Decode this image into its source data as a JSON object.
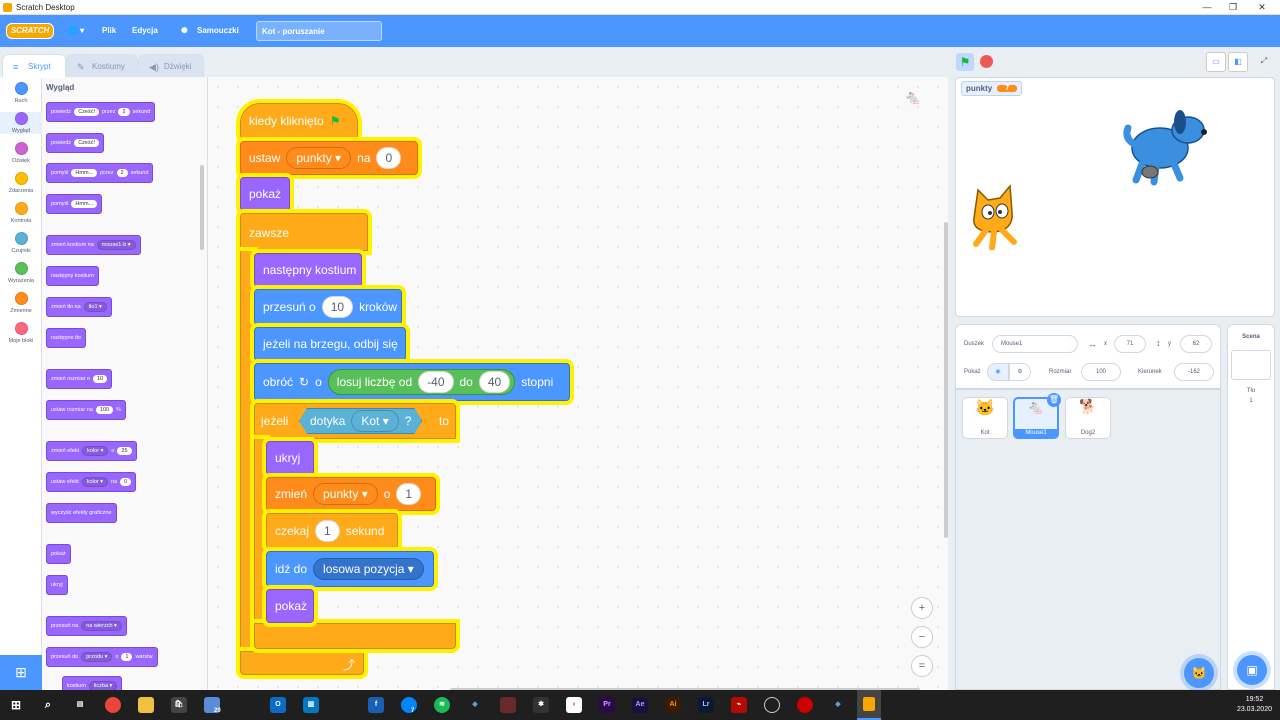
{
  "window": {
    "title": "Scratch Desktop",
    "minimize": "—",
    "maximize": "❐",
    "close": "✕"
  },
  "menubar": {
    "logo": "SCRATCH",
    "globe": "🌐 ▾",
    "file": "Plik",
    "edit": "Edycja",
    "tutorials": "Samouczki",
    "project_title": "Kot - poruszanie"
  },
  "tabs": {
    "code": "Skrypt",
    "costumes": "Kostiumy",
    "sounds": "Dźwięki"
  },
  "categories": [
    {
      "label": "Ruch",
      "color": "#4c97ff"
    },
    {
      "label": "Wygląd",
      "color": "#9966ff"
    },
    {
      "label": "Dźwięk",
      "color": "#cf63cf"
    },
    {
      "label": "Zdarzenia",
      "color": "#ffbf00"
    },
    {
      "label": "Kontrola",
      "color": "#ffab19"
    },
    {
      "label": "Czujniki",
      "color": "#5cb1d6"
    },
    {
      "label": "Wyrażenia",
      "color": "#59c059"
    },
    {
      "label": "Zmienne",
      "color": "#ff8c1a"
    },
    {
      "label": "Moje bloki",
      "color": "#ff6680"
    }
  ],
  "palette": {
    "heading": "Wygląd",
    "b1": {
      "a": "powiedz",
      "v": "Cześć!",
      "b": "przez",
      "n": "2",
      "c": "sekund"
    },
    "b2": {
      "a": "powiedz",
      "v": "Cześć!"
    },
    "b3": {
      "a": "pomyśl",
      "v": "Hmm...",
      "b": "przez",
      "n": "2",
      "c": "sekund"
    },
    "b4": {
      "a": "pomyśl",
      "v": "Hmm..."
    },
    "b5": {
      "a": "zmień kostium na",
      "dd": "mouse1-b ▾"
    },
    "b6": "następny kostium",
    "b7": {
      "a": "zmień tło na",
      "dd": "tło1 ▾"
    },
    "b8": "następne tło",
    "b9": {
      "a": "zmień rozmiar o",
      "v": "10"
    },
    "b10": {
      "a": "ustaw rozmiar na",
      "v": "100",
      "b": "%"
    },
    "b11": {
      "a": "zmień efekt",
      "dd": "kolor ▾",
      "b": "o",
      "v": "25"
    },
    "b12": {
      "a": "ustaw efekt",
      "dd": "kolor ▾",
      "b": "na",
      "v": "0"
    },
    "b13": "wyczyść efekty graficzne",
    "b14": "pokaż",
    "b15": "ukryj",
    "b16": {
      "a": "przesuń na",
      "dd": "na wierzch ▾"
    },
    "b17": {
      "a": "przesuń do",
      "dd": "przodu ▾",
      "b": "o",
      "v": "1",
      "c": "warstw"
    },
    "b18": {
      "a": "kostium",
      "dd": "liczba ▾"
    }
  },
  "script": {
    "hat": "kiedy kliknięto",
    "set_var": {
      "a": "ustaw",
      "var": "punkty",
      "b": "na",
      "v": "0"
    },
    "show1": "pokaż",
    "forever": "zawsze",
    "next_costume": "następny kostium",
    "move": {
      "a": "przesuń o",
      "v": "10",
      "b": "kroków"
    },
    "bounce": "jeżeli na brzegu, odbij się",
    "turn": {
      "a": "obróć",
      "b": "o",
      "c": "losuj liczbę od",
      "v1": "-40",
      "d": "do",
      "v2": "40",
      "e": "stopni"
    },
    "if": {
      "a": "jeżeli",
      "b": "dotyka",
      "dd": "Kot",
      "c": "?",
      "d": "to"
    },
    "hide": "ukryj",
    "change_var": {
      "a": "zmień",
      "var": "punkty",
      "b": "o",
      "v": "1"
    },
    "wait": {
      "a": "czekaj",
      "v": "1",
      "b": "sekund"
    },
    "goto": {
      "a": "idź do",
      "dd": "losowa pozycja"
    },
    "show2": "pokaż"
  },
  "zoom": {
    "in": "+",
    "out": "−",
    "reset": "="
  },
  "monitor": {
    "label": "punkty",
    "value": "7"
  },
  "sprite_info": {
    "sprite_label": "Duszek",
    "sprite_name": "Mouse1",
    "x_label": "x",
    "x": "71",
    "y_label": "y",
    "y": "62",
    "show_label": "Pokaż",
    "size_label": "Rozmiar",
    "size": "100",
    "direction_label": "Kierunek",
    "direction": "-162"
  },
  "sprites": [
    {
      "name": "Kot"
    },
    {
      "name": "Mouse1"
    },
    {
      "name": "Dog2"
    }
  ],
  "stage_panel": {
    "title": "Scena",
    "backdrops_label": "Tło",
    "backdrops_count": "1"
  },
  "taskbar": {
    "time": "19:52",
    "date": "23.03.2020",
    "badge1": "20",
    "badge2": "7"
  }
}
